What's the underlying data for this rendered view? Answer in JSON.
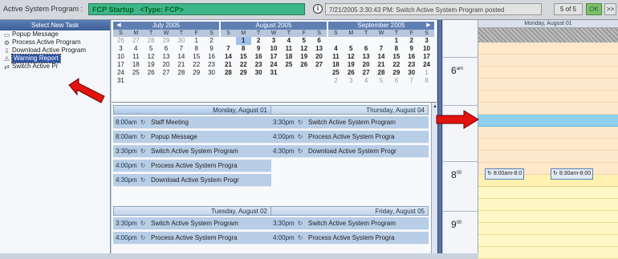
{
  "topbar": {
    "label": "Active System Program :",
    "program_name": "FCP Startup",
    "program_type": "<Type: FCP>",
    "status_message": "7/21/2005 3:30:43 PM: Switch Active System Program posted",
    "count": "5 of 5",
    "ok_label": "OK",
    "more_label": ">>"
  },
  "left_panel": {
    "header": "Select New Task",
    "tasks": [
      {
        "label": "Popup Message",
        "icon": "message-icon"
      },
      {
        "label": "Process Active Program",
        "icon": "process-icon"
      },
      {
        "label": "Download Active Program",
        "icon": "download-icon"
      },
      {
        "label": "Warning Report",
        "icon": "warning-icon",
        "selected": true
      },
      {
        "label": "Switch Active Pr",
        "icon": "switch-icon"
      }
    ]
  },
  "calendar": {
    "dow": [
      "S",
      "M",
      "T",
      "W",
      "T",
      "F",
      "S"
    ],
    "months": [
      {
        "title": "July 2005",
        "days": [
          "26",
          "27",
          "28",
          "29",
          "30",
          "1",
          "2",
          "3",
          "4",
          "5",
          "6",
          "7",
          "8",
          "9",
          "10",
          "11",
          "12",
          "13",
          "14",
          "15",
          "16",
          "17",
          "18",
          "19",
          "20",
          "21",
          "22",
          "23",
          "24",
          "25",
          "26",
          "27",
          "28",
          "29",
          "30",
          "31"
        ]
      },
      {
        "title": "August 2005",
        "days": [
          "",
          "1",
          "2",
          "3",
          "4",
          "5",
          "6",
          "7",
          "8",
          "9",
          "10",
          "11",
          "12",
          "13",
          "14",
          "15",
          "16",
          "17",
          "18",
          "19",
          "20",
          "21",
          "22",
          "23",
          "24",
          "25",
          "26",
          "27",
          "28",
          "29",
          "30",
          "31"
        ]
      },
      {
        "title": "September 2005",
        "days": [
          "",
          "",
          "",
          "",
          "1",
          "2",
          "3",
          "4",
          "5",
          "6",
          "7",
          "8",
          "9",
          "10",
          "11",
          "12",
          "13",
          "14",
          "15",
          "16",
          "17",
          "18",
          "19",
          "20",
          "21",
          "22",
          "23",
          "24",
          "25",
          "26",
          "27",
          "28",
          "29",
          "30",
          "1",
          "2",
          "3",
          "4",
          "5",
          "6",
          "7",
          "8"
        ]
      }
    ]
  },
  "agenda": {
    "monday": {
      "title": "Monday, August 01",
      "items": [
        {
          "time": "8:00am",
          "text": "Staff Meeting"
        },
        {
          "time": "8:00am",
          "text": "Popup Message"
        },
        {
          "time": "3:30pm",
          "text": "Switch Active System Program"
        },
        {
          "time": "4:00pm",
          "text": "Process Active System Progra"
        },
        {
          "time": "4:30pm",
          "text": "Download Active System Progr"
        }
      ]
    },
    "thursday": {
      "title": "Thursday, August 04",
      "items": [
        {
          "time": "3:30pm",
          "text": "Switch Active System Program"
        },
        {
          "time": "4:00pm",
          "text": "Process Active System Progra"
        },
        {
          "time": "4:30pm",
          "text": "Download Active System Progr"
        }
      ]
    },
    "tuesday": {
      "title": "Tuesday, August 02",
      "items": [
        {
          "time": "3:30pm",
          "text": "Switch Active System Program"
        },
        {
          "time": "4:00pm",
          "text": "Process Active System Progra"
        }
      ]
    },
    "friday": {
      "title": "Friday, August 05",
      "items": [
        {
          "time": "3:30pm",
          "text": "Switch Active System Program"
        },
        {
          "time": "4:00pm",
          "text": "Process Active System Progra"
        }
      ]
    }
  },
  "dayview": {
    "title": "Monday, August 01",
    "hours": [
      {
        "hour": "6",
        "suffix": "am"
      },
      {
        "hour": "8",
        "suffix": "00"
      },
      {
        "hour": "9",
        "suffix": "00"
      }
    ],
    "appointments": [
      {
        "text": "8:00am-8:0"
      },
      {
        "text": "8:30am-8:00"
      }
    ]
  },
  "colors": {
    "program_bar": "#3fb58a",
    "accent": "#3d5f98",
    "arrow": "#e3130f",
    "slot_blue": "#8fd0ef",
    "slot_peach": "#fde8cc",
    "slot_yellow": "#fff8c6"
  }
}
